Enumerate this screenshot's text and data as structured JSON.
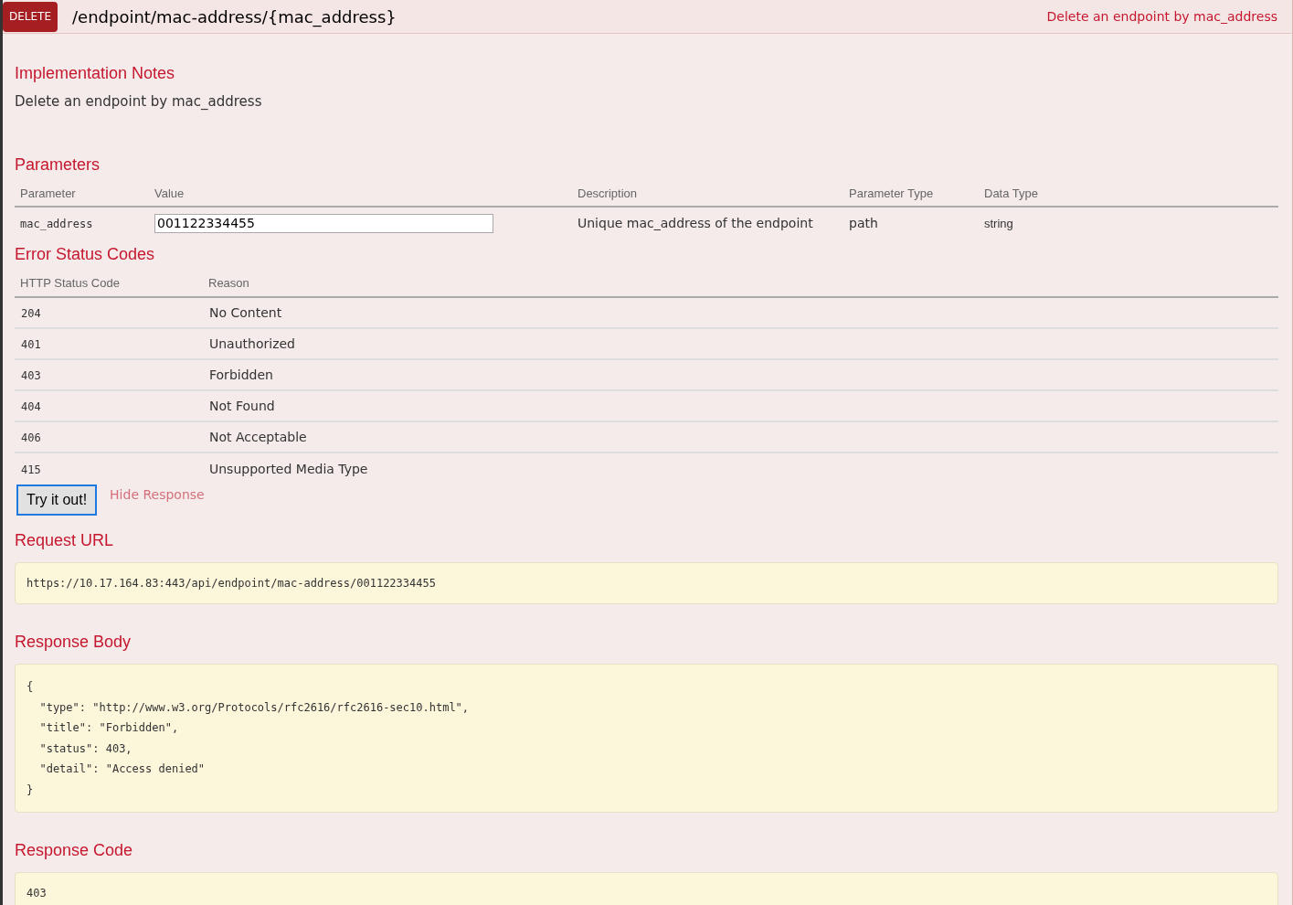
{
  "operation": {
    "method": "DELETE",
    "path": "/endpoint/mac-address/{mac_address}",
    "summary": "Delete an endpoint by mac_address"
  },
  "implementation_notes": {
    "heading": "Implementation Notes",
    "text": "Delete an endpoint by mac_address"
  },
  "parameters": {
    "heading": "Parameters",
    "columns": [
      "Parameter",
      "Value",
      "Description",
      "Parameter Type",
      "Data Type"
    ],
    "rows": [
      {
        "parameter": "mac_address",
        "value": "001122334455",
        "description": "Unique mac_address of the endpoint",
        "parameter_type": "path",
        "data_type": "string"
      }
    ]
  },
  "error_status_codes": {
    "heading": "Error Status Codes",
    "columns": [
      "HTTP Status Code",
      "Reason"
    ],
    "rows": [
      {
        "code": "204",
        "reason": "No Content"
      },
      {
        "code": "401",
        "reason": "Unauthorized"
      },
      {
        "code": "403",
        "reason": "Forbidden"
      },
      {
        "code": "404",
        "reason": "Not Found"
      },
      {
        "code": "406",
        "reason": "Not Acceptable"
      },
      {
        "code": "415",
        "reason": "Unsupported Media Type"
      }
    ]
  },
  "try_button": "Try it out!",
  "hide_link": "Hide Response",
  "request_url": {
    "heading": "Request URL",
    "value": "https://10.17.164.83:443/api/endpoint/mac-address/001122334455"
  },
  "response_body": {
    "heading": "Response Body",
    "value": "{\n  \"type\": \"http://www.w3.org/Protocols/rfc2616/rfc2616-sec10.html\",\n  \"title\": \"Forbidden\",\n  \"status\": 403,\n  \"detail\": \"Access denied\"\n}"
  },
  "response_code": {
    "heading": "Response Code",
    "value": "403"
  }
}
